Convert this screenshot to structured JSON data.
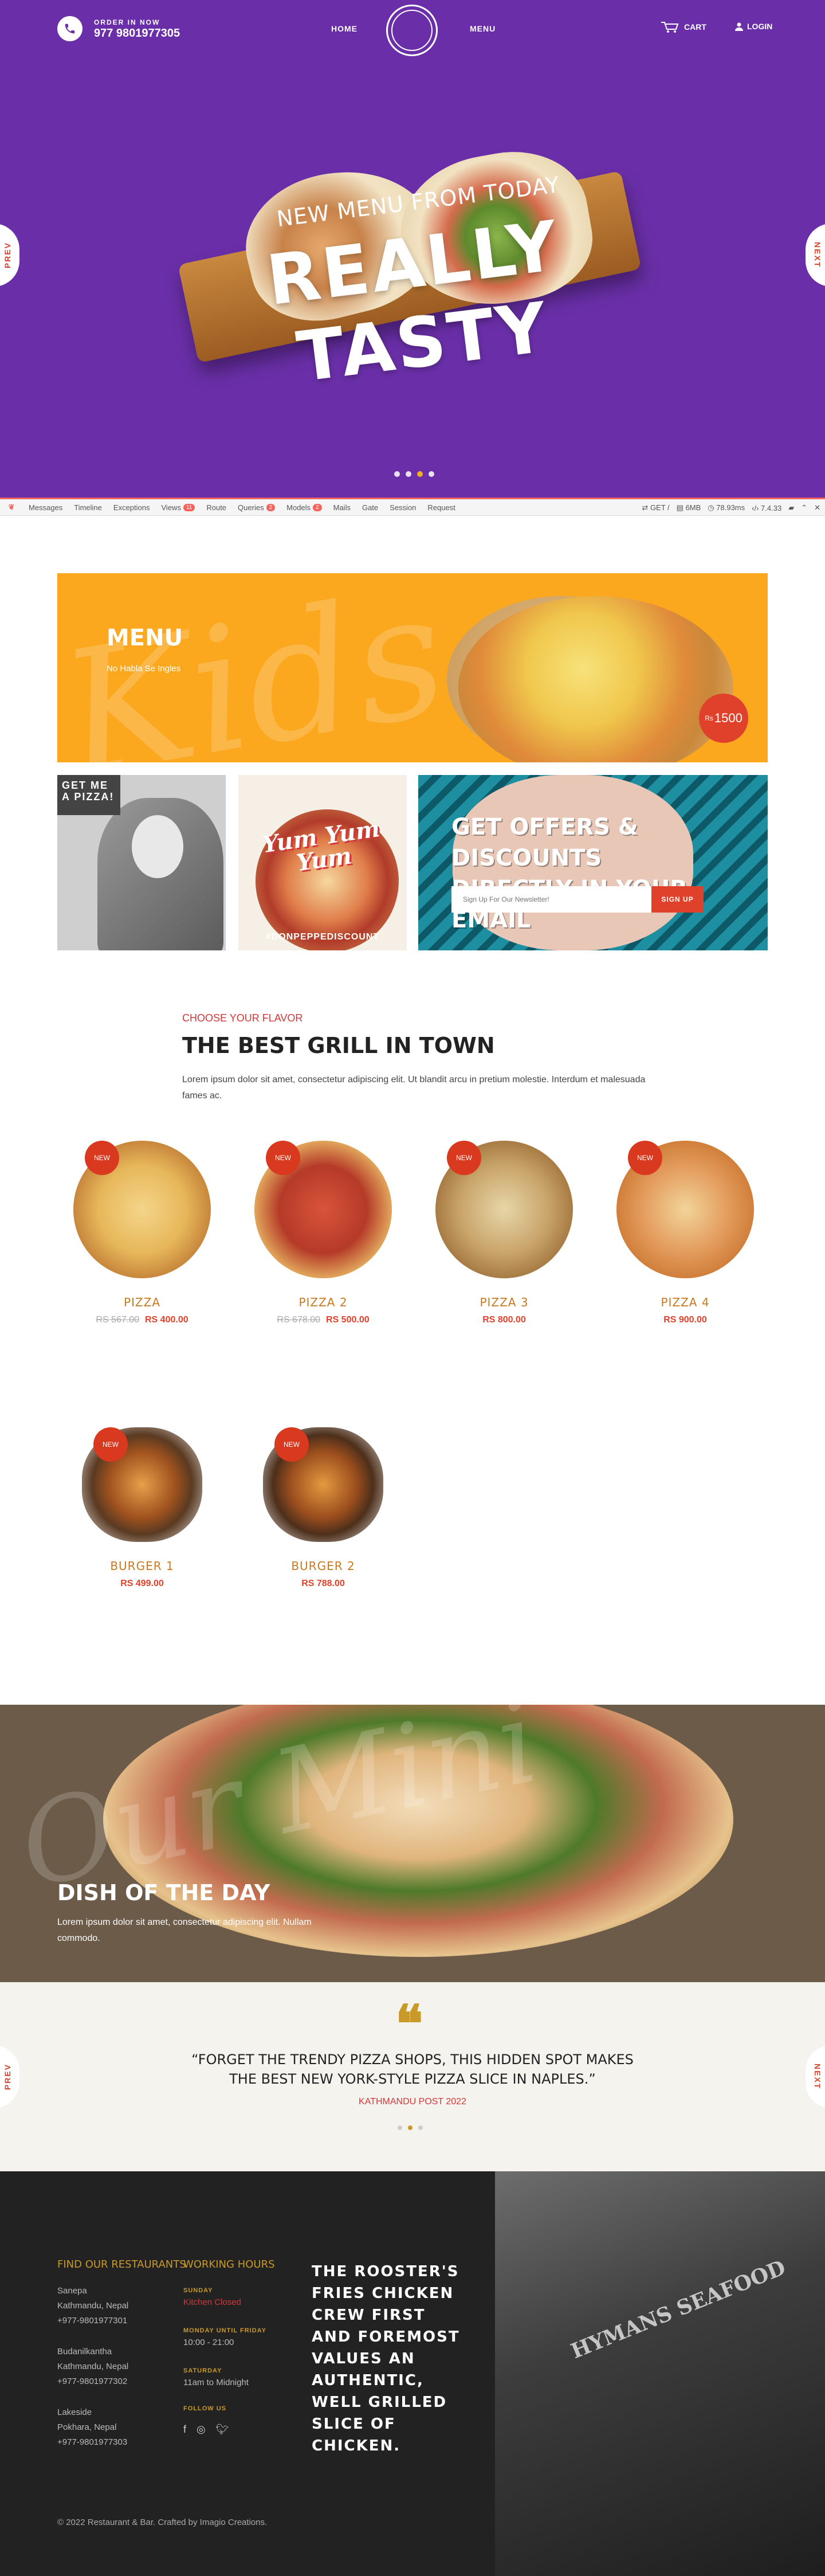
{
  "header": {
    "order_label": "ORDER IN NOW",
    "order_phone": "977 9801977305",
    "nav": [
      "HOME",
      "MENU"
    ],
    "cart_label": "CART",
    "login_label": "LOGIN",
    "slider_prev": "PREV",
    "slider_next": "NEXT"
  },
  "hero": {
    "subtitle": "NEW MENU FROM TODAY",
    "title": "REALLY TASTY",
    "slide_count": 4,
    "active_slide": 2
  },
  "debugbar": {
    "tabs": [
      {
        "label": "Messages",
        "badge": ""
      },
      {
        "label": "Timeline",
        "badge": ""
      },
      {
        "label": "Exceptions",
        "badge": ""
      },
      {
        "label": "Views",
        "badge": "11"
      },
      {
        "label": "Route",
        "badge": ""
      },
      {
        "label": "Queries",
        "badge": "2"
      },
      {
        "label": "Models",
        "badge": "2"
      },
      {
        "label": "Mails",
        "badge": ""
      },
      {
        "label": "Gate",
        "badge": ""
      },
      {
        "label": "Session",
        "badge": ""
      },
      {
        "label": "Request",
        "badge": ""
      }
    ],
    "method": "GET /",
    "memory": "6MB",
    "time": "78.93ms",
    "php_version": "7.4.33"
  },
  "kids_banner": {
    "script_text": "Kids",
    "title": "MENU",
    "subtitle": "No Habla Se Ingles",
    "price_currency": "Rs",
    "price": "1500"
  },
  "promos": {
    "comic_text": "GET ME A PIZZA!",
    "yum_text": "Yum Yum Yum",
    "hashtag": "#DONPEPPEDISCOUNT",
    "offer_title_line1": "GET OFFERS & DISCOUNTS",
    "offer_title_line2": "DIRECTLY IN YOUR EMAIL",
    "newsletter_placeholder": "Sign Up For Our Newsletter!",
    "newsletter_button": "SIGN UP"
  },
  "grill": {
    "eyebrow": "CHOOSE YOUR FLAVOR",
    "title": "THE BEST GRILL IN TOWN",
    "description": "Lorem ipsum dolor sit amet, consectetur adipiscing elit. Ut blandit arcu in pretium molestie. Interdum et malesuada fames ac."
  },
  "products": [
    {
      "name": "PIZZA",
      "old_price": "RS 567.00",
      "price": "RS 400.00",
      "badge": "NEW"
    },
    {
      "name": "PIZZA 2",
      "old_price": "RS 678.00",
      "price": "RS 500.00",
      "badge": "NEW"
    },
    {
      "name": "PIZZA 3",
      "old_price": "",
      "price": "RS 800.00",
      "badge": "NEW"
    },
    {
      "name": "PIZZA 4",
      "old_price": "",
      "price": "RS 900.00",
      "badge": "NEW"
    },
    {
      "name": "BURGER 1",
      "old_price": "",
      "price": "RS 499.00",
      "badge": "NEW"
    },
    {
      "name": "BURGER 2",
      "old_price": "",
      "price": "RS 788.00",
      "badge": "NEW"
    }
  ],
  "dish": {
    "script_text": "Our Mini",
    "title": "DISH OF THE DAY",
    "description": "Lorem ipsum dolor sit amet, consectetur adipiscing elit. Nullam commodo."
  },
  "testimonial": {
    "quote": "“FORGET THE TRENDY PIZZA SHOPS, THIS HIDDEN SPOT MAKES THE BEST NEW YORK-STYLE PIZZA SLICE IN NAPLES.”",
    "source": "KATHMANDU POST 2022",
    "prev": "PREV",
    "next": "NEXT",
    "dot_count": 3,
    "active_dot": 1
  },
  "footer": {
    "restaurants_heading": "FIND OUR RESTAURANTS",
    "restaurants": [
      {
        "line1": "Sanepa",
        "line2": "Kathmandu, Nepal",
        "line3": "+977-9801977301"
      },
      {
        "line1": "Budanilkantha",
        "line2": "Kathmandu, Nepal",
        "line3": "+977-9801977302"
      },
      {
        "line1": "Lakeside",
        "line2": "Pokhara, Nepal",
        "line3": "+977-9801977303"
      }
    ],
    "hours_heading": "WORKING HOURS",
    "hours": [
      {
        "label": "SUNDAY",
        "value": "Kitchen Closed"
      },
      {
        "label": "MONDAY UNTIL FRIDAY",
        "value": "10:00 - 21:00"
      },
      {
        "label": "SATURDAY",
        "value": "11am to Midnight"
      }
    ],
    "follow_label": "FOLLOW US",
    "tagline": "THE ROOSTER'S FRIES CHICKEN CREW FIRST AND FOREMOST VALUES AN AUTHENTIC, WELL GRILLED SLICE OF CHICKEN.",
    "photo_sign": "HYMANS SEAFOOD",
    "copyright": "© 2022 Restaurant & Bar. Crafted by Imagio Creations."
  },
  "colors": {
    "hero_bg": "#6a2fa8",
    "kids_bg": "#fba81f",
    "accent_red": "#d3373a",
    "accent_gold": "#c99a2a",
    "footer_bg": "#222222"
  }
}
